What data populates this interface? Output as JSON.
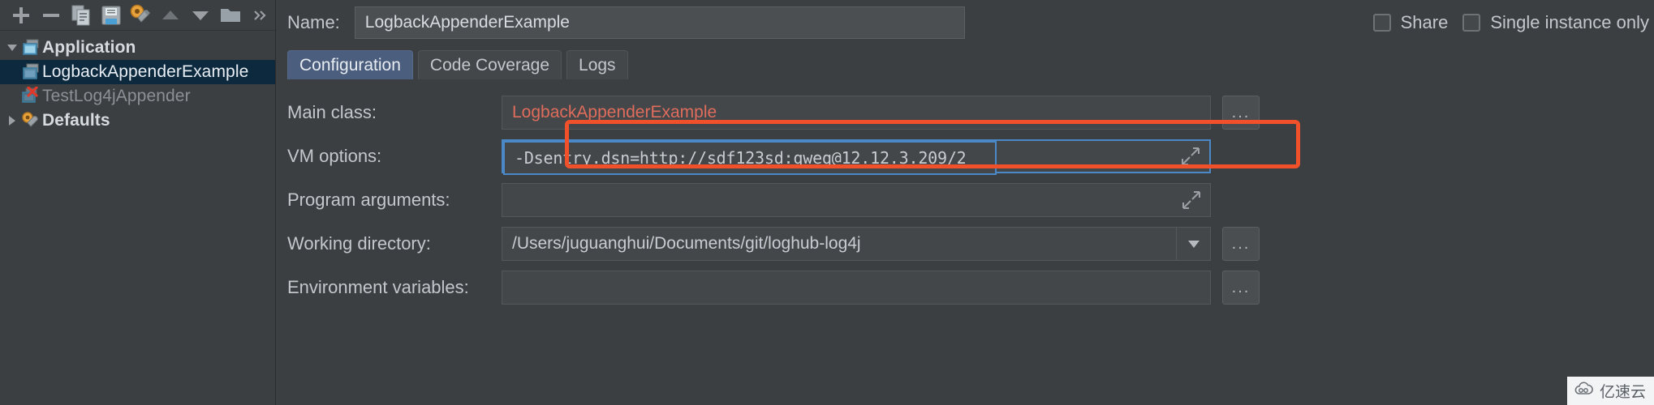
{
  "toolbar": {
    "buttons": [
      {
        "name": "add-icon",
        "label": "+"
      },
      {
        "name": "remove-icon",
        "label": "−"
      },
      {
        "name": "copy-icon",
        "label": "Copy Configuration"
      },
      {
        "name": "save-icon",
        "label": "Save Configuration"
      },
      {
        "name": "edit-defaults-icon",
        "label": "Edit defaults"
      },
      {
        "name": "move-up-icon",
        "label": "Move Up"
      },
      {
        "name": "move-down-icon",
        "label": "Move Down"
      },
      {
        "name": "folder-icon",
        "label": "New Folder"
      },
      {
        "name": "overflow-icon",
        "label": "»"
      }
    ]
  },
  "tree": {
    "items": [
      {
        "label": "Application",
        "icon": "application-icon",
        "state": "bold",
        "expanded": true,
        "indent": 0
      },
      {
        "label": "LogbackAppenderExample",
        "icon": "run-config-icon",
        "state": "selected",
        "indent": 1
      },
      {
        "label": "TestLog4jAppender",
        "icon": "run-config-error-icon",
        "state": "dim",
        "indent": 1
      },
      {
        "label": "Defaults",
        "icon": "defaults-icon",
        "state": "bold",
        "expanded": false,
        "indent": 0
      }
    ]
  },
  "header": {
    "name_label": "Name:",
    "name_value": "LogbackAppenderExample",
    "share_label": "Share",
    "share_checked": false,
    "single_instance_label": "Single instance only",
    "single_instance_checked": false
  },
  "tabs": [
    {
      "label": "Configuration",
      "active": true
    },
    {
      "label": "Code Coverage",
      "active": false
    },
    {
      "label": "Logs",
      "active": false
    }
  ],
  "form": {
    "rows": [
      {
        "label": "Main class:",
        "value": "LogbackAppenderExample",
        "state": "error",
        "browse": "...",
        "placeholder": ""
      },
      {
        "label": "VM options:",
        "value": "-Dsentry.dsn=http://sdf123sd:qweq@12.12.3.209/2",
        "state": "focused",
        "expand": "expand-icon",
        "placeholder": ""
      },
      {
        "label": "Program arguments:",
        "value": "",
        "state": "normal",
        "expand": "expand-icon",
        "placeholder": ""
      },
      {
        "label": "Working directory:",
        "value": "/Users/juguanghui/Documents/git/loghub-log4j",
        "state": "normal",
        "dropdown": true,
        "browse": "...",
        "placeholder": ""
      },
      {
        "label": "Environment variables:",
        "value": "",
        "state": "normal",
        "browse": "...",
        "placeholder": ""
      }
    ]
  },
  "annotation": {
    "color": "#f0502a",
    "target": "vm-options-row"
  },
  "watermark": {
    "text": "亿速云",
    "icon": "cloud-icon"
  },
  "colors": {
    "background": "#3c3f41",
    "accent": "#4a88c7",
    "error": "#e06c5c",
    "annotation": "#f0502a",
    "tab_active": "#4b5e7d",
    "selection": "#0d293e"
  }
}
